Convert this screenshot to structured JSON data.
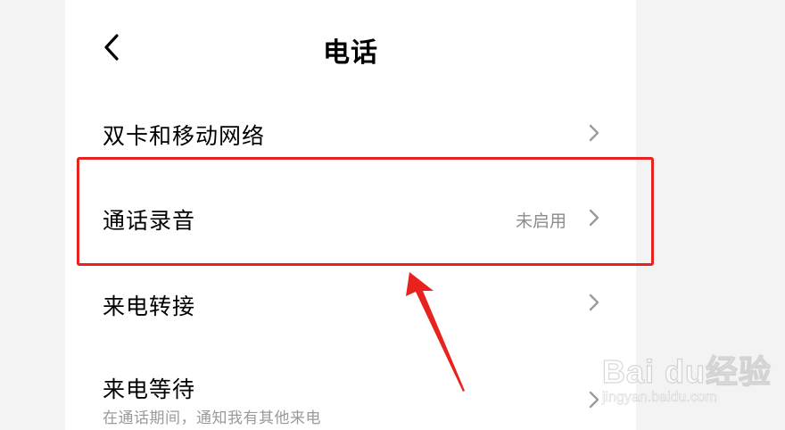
{
  "header": {
    "title": "电话"
  },
  "settings": [
    {
      "label": "双卡和移动网络",
      "value": "",
      "subtitle": ""
    },
    {
      "label": "通话录音",
      "value": "未启用",
      "subtitle": ""
    },
    {
      "label": "来电转接",
      "value": "",
      "subtitle": ""
    },
    {
      "label": "来电等待",
      "value": "",
      "subtitle": "在通话期间，通知我有其他来电"
    }
  ],
  "annotation": {
    "highlight_color": "#e8231f"
  },
  "watermark": {
    "brand": "Bai du经验",
    "url": "jingyan.baidu.com"
  },
  "colors": {
    "background": "#f3f3f3",
    "screen": "#ffffff",
    "text_primary": "#000000",
    "text_secondary": "#8c8c8c"
  }
}
